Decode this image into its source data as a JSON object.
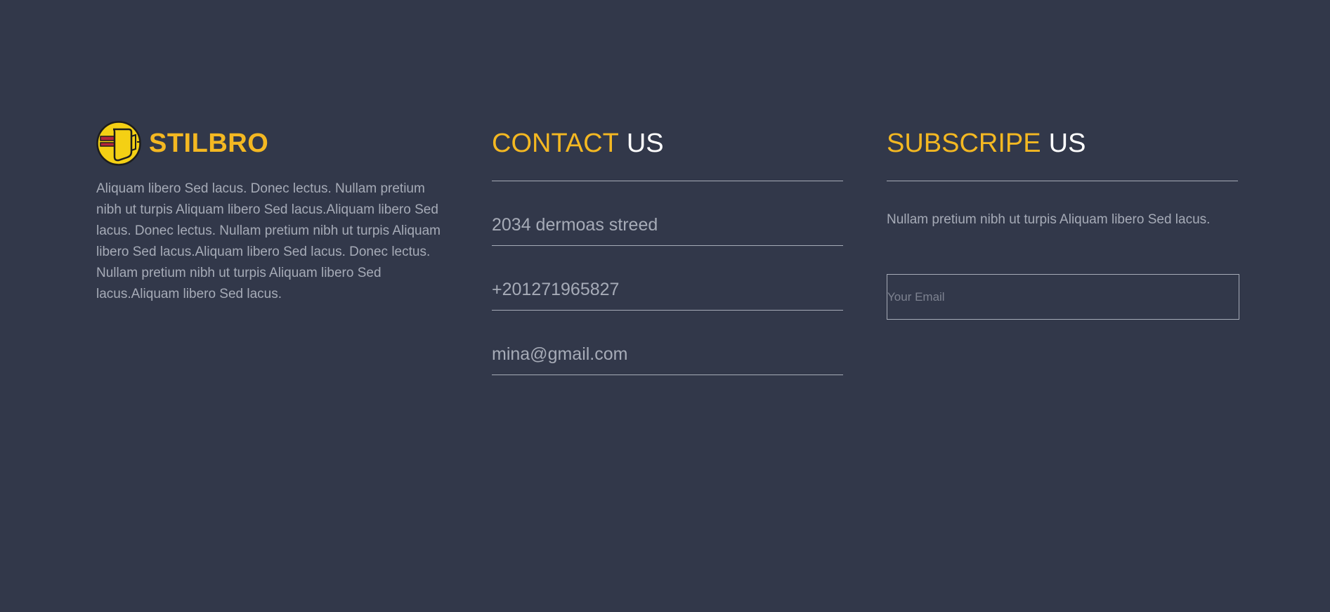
{
  "brand": {
    "name": "STILBRO",
    "description": "Aliquam libero Sed lacus. Donec lectus. Nullam pretium nibh ut turpis Aliquam libero Sed lacus.Aliquam libero Sed lacus. Donec lectus. Nullam pretium nibh ut turpis Aliquam libero Sed lacus.Aliquam libero Sed lacus. Donec lectus. Nullam pretium nibh ut turpis Aliquam libero Sed lacus.Aliquam libero Sed lacus.",
    "logo_icon": "yellow-circle-door-logo"
  },
  "contact": {
    "title_accent": "CONTACT",
    "title_plain": "US",
    "address": "2034 dermoas streed",
    "phone": "+201271965827",
    "email": "mina@gmail.com"
  },
  "subscribe": {
    "title_accent": "SUBSCRIPE",
    "title_plain": "US",
    "text": "Nullam pretium nibh ut turpis Aliquam libero Sed lacus.",
    "email_placeholder": "Your Email"
  },
  "colors": {
    "background": "#32384a",
    "accent": "#f4b822",
    "muted_text": "#a6abb7",
    "white": "#ffffff"
  }
}
